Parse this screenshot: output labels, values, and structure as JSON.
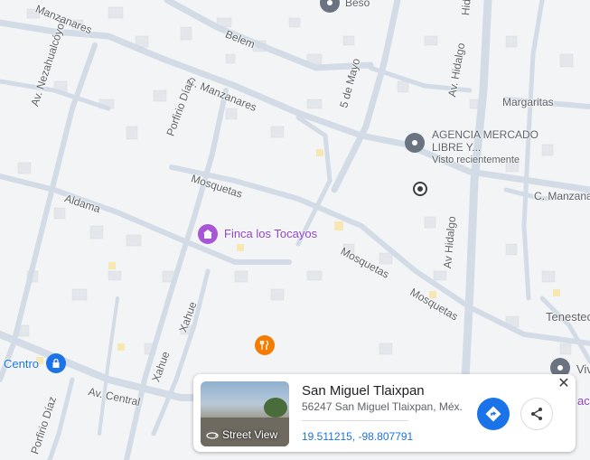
{
  "map": {
    "roads": [
      "Belem",
      "C. Manzanares",
      "Av. Nezahualcóyotl",
      "Porfirio Díaz",
      "5 de Mayo",
      "Av. Hidalgo",
      "Av Hidalgo",
      "Hidalgo",
      "Margaritas",
      "Mosquetas",
      "Mosquetas",
      "Mosquetas",
      "Aldama",
      "C. Manzana",
      "Xahue",
      "Xahue",
      "Av. Central",
      "Porfirio Díaz",
      "Manzanares"
    ],
    "pois": {
      "beso": "Beso",
      "agencia_line1": "AGENCIA MERCADO",
      "agencia_line2": "LIBRE Y...",
      "agencia_sub": "Visto recientemente",
      "finca": "Finca los Tocayos",
      "centro": "Centro",
      "tenestec": "Tenestec",
      "viv": "Viv",
      "ac": "ac"
    }
  },
  "card": {
    "title": "San Miguel Tlaixpan",
    "address": "56247 San Miguel Tlaixpan, Méx.",
    "coords": "19.511215, -98.807791",
    "street_view": "Street View",
    "close": "✕"
  }
}
